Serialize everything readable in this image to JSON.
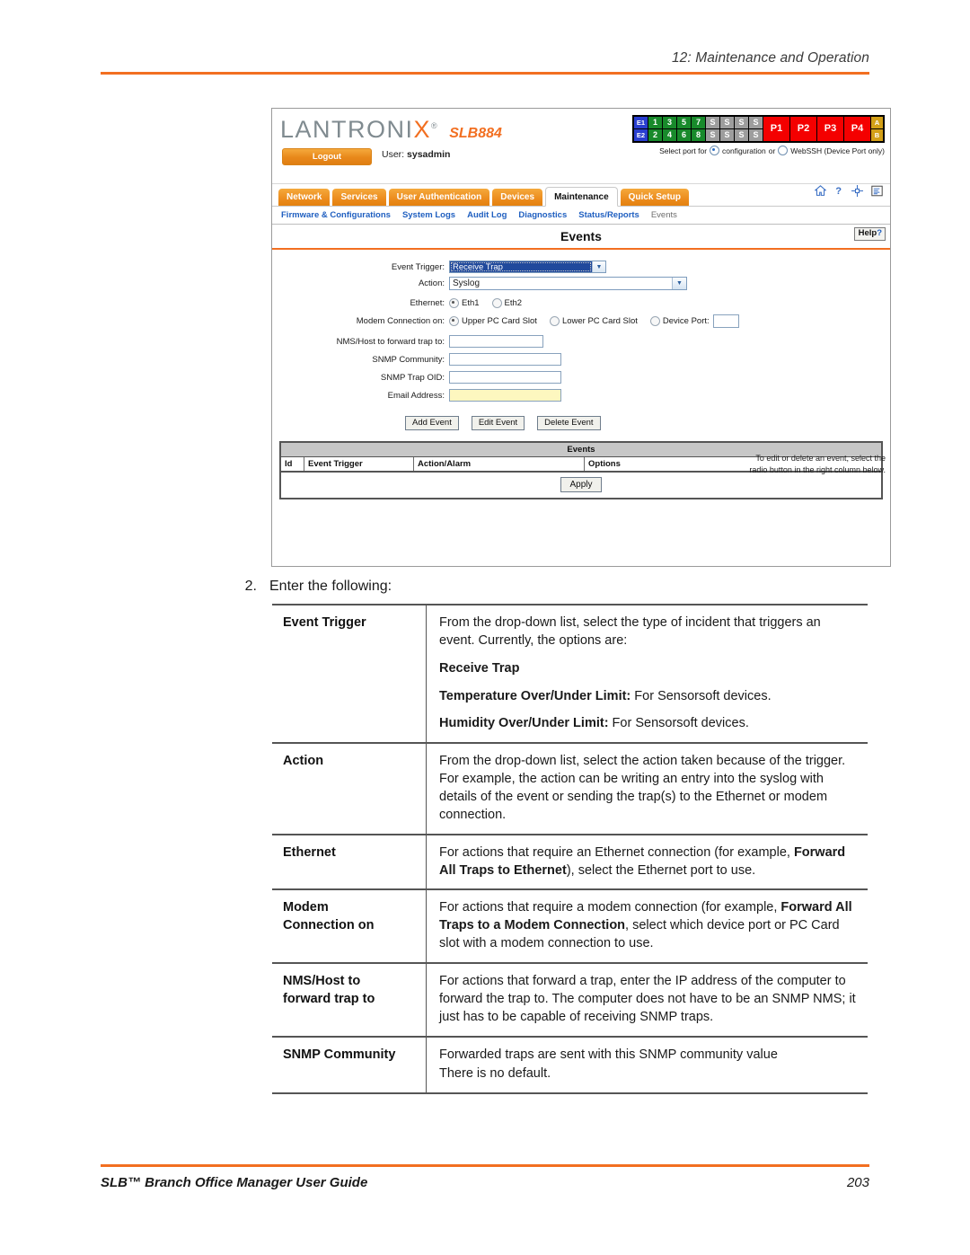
{
  "page": {
    "header_title": "12: Maintenance and Operation",
    "footer_title": "SLB™ Branch Office Manager User Guide",
    "footer_page": "203",
    "accent_color": "#f26f21"
  },
  "step": {
    "number": "2.",
    "text": "Enter the following:"
  },
  "device_ui": {
    "brand": {
      "logo_text": "LANTRONI",
      "logo_x": "X",
      "logo_reg": "®",
      "model": "SLB884"
    },
    "logout_label": "Logout",
    "user_prefix": "User:",
    "user_name": "sysadmin",
    "port_map": {
      "eth_labels": [
        "E1",
        "E2"
      ],
      "num_top": [
        "1",
        "3",
        "5",
        "7"
      ],
      "num_bottom": [
        "2",
        "4",
        "6",
        "8"
      ],
      "s_top": [
        "S",
        "S",
        "S",
        "S"
      ],
      "s_bottom": [
        "S",
        "S",
        "S",
        "S"
      ],
      "power_labels": [
        "P1",
        "P2",
        "P3",
        "P4"
      ],
      "ab_labels": [
        "A",
        "B"
      ],
      "colors": {
        "ethernet": "#2a3fd0",
        "device_port": "#188a2b",
        "inactive": "#9d9d9d",
        "power": "#f40000",
        "ab": "#d4a017"
      }
    },
    "select_port": {
      "prefix": "Select port for",
      "option_configuration": "configuration",
      "separator": "or",
      "option_webssh": "WebSSH (Device Port only)",
      "selected": "configuration"
    },
    "tabs": [
      {
        "label": "Network",
        "active": false
      },
      {
        "label": "Services",
        "active": false
      },
      {
        "label": "User Authentication",
        "active": false
      },
      {
        "label": "Devices",
        "active": false
      },
      {
        "label": "Maintenance",
        "active": true
      },
      {
        "label": "Quick Setup",
        "active": false
      }
    ],
    "header_icons": [
      "home-icon",
      "help-question-icon",
      "sitemap-icon",
      "log-list-icon"
    ],
    "subnav": [
      {
        "label": "Firmware & Configurations",
        "current": false
      },
      {
        "label": "System Logs",
        "current": false
      },
      {
        "label": "Audit Log",
        "current": false
      },
      {
        "label": "Diagnostics",
        "current": false
      },
      {
        "label": "Status/Reports",
        "current": false
      },
      {
        "label": "Events",
        "current": true
      }
    ],
    "content_title": "Events",
    "help_label": "Help",
    "help_mark": "?",
    "form": {
      "event_trigger_label": "Event Trigger:",
      "event_trigger_value": "Receive Trap",
      "action_label": "Action:",
      "action_value": "Syslog",
      "ethernet_label": "Ethernet:",
      "ethernet_options": [
        {
          "label": "Eth1",
          "selected": true
        },
        {
          "label": "Eth2",
          "selected": false
        }
      ],
      "modem_label": "Modem Connection on:",
      "modem_options": [
        {
          "label": "Upper PC Card Slot",
          "selected": true
        },
        {
          "label": "Lower PC Card Slot",
          "selected": false
        },
        {
          "label": "Device Port:",
          "selected": false
        }
      ],
      "device_port_value": "",
      "nms_label": "NMS/Host to forward trap to:",
      "nms_value": "",
      "snmp_community_label": "SNMP Community:",
      "snmp_community_value": "",
      "snmp_trap_oid_label": "SNMP Trap OID:",
      "snmp_trap_oid_value": "",
      "email_label": "Email Address:",
      "email_value": ""
    },
    "buttons": {
      "add_event": "Add Event",
      "edit_event": "Edit Event",
      "delete_event": "Delete Event",
      "apply": "Apply"
    },
    "note": "To edit or delete an event, select the radio button in the right column below.",
    "events_table": {
      "title": "Events",
      "columns": [
        "Id",
        "Event Trigger",
        "Action/Alarm",
        "Options"
      ],
      "rows": []
    }
  },
  "reference_table": {
    "rows": [
      {
        "term": "Event Trigger",
        "paragraphs": [
          {
            "text": "From the drop-down list, select the type of incident that triggers an event. Currently, the options are:"
          },
          {
            "bold_lead": "Receive Trap",
            "text": ""
          },
          {
            "bold_lead": "Temperature Over/Under Limit:",
            "text": " For Sensorsoft devices."
          },
          {
            "bold_lead": "Humidity Over/Under Limit:",
            "text": " For Sensorsoft devices."
          }
        ]
      },
      {
        "term": "Action",
        "paragraphs": [
          {
            "text": "From the drop-down list, select the action taken because of the trigger. For example, the action can be writing an entry into the syslog with details of the event or sending the trap(s) to the Ethernet or modem connection."
          }
        ]
      },
      {
        "term": "Ethernet",
        "paragraphs": [
          {
            "text": "For actions that require an Ethernet connection (for example, "
          },
          {
            "bold_lead": "Forward All Traps to Ethernet",
            "text": "), select the Ethernet port to use.",
            "inline": true
          }
        ]
      },
      {
        "term": "Modem Connection on",
        "term_line1": "Modem",
        "term_line2": "Connection on",
        "paragraphs": [
          {
            "text": "For actions that require a modem connection (for example, "
          },
          {
            "bold_lead": "Forward All Traps to a Modem Connection",
            "text": ", select which device port or PC Card slot with a modem connection to use.",
            "inline": true
          }
        ]
      },
      {
        "term": "NMS/Host to forward trap to",
        "term_line1": "NMS/Host to",
        "term_line2": "forward trap to",
        "paragraphs": [
          {
            "text": "For actions that forward a trap, enter the IP address of the computer to forward the trap to. The computer does not have to be an SNMP NMS; it just has to be capable of receiving SNMP traps."
          }
        ]
      },
      {
        "term": "SNMP Community",
        "paragraphs": [
          {
            "text": "Forwarded traps are sent with this SNMP community value"
          },
          {
            "text": "There is no default.",
            "tight": true
          }
        ]
      }
    ]
  }
}
